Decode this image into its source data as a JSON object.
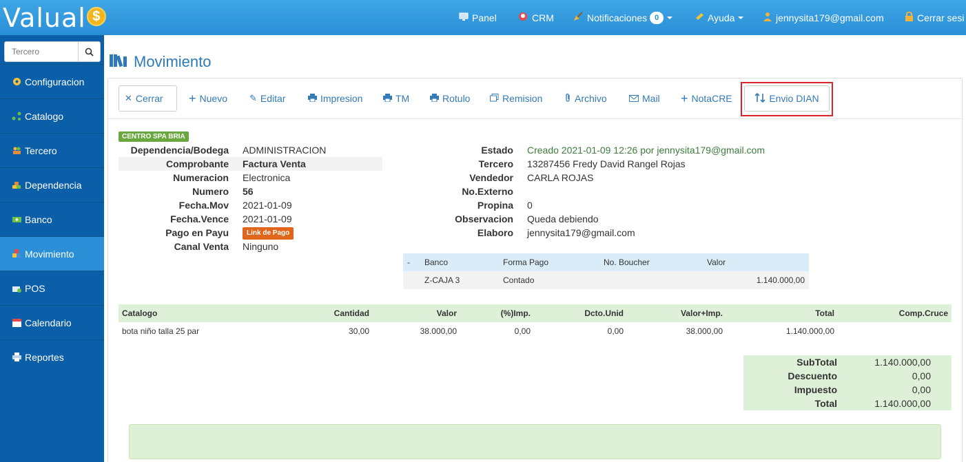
{
  "header": {
    "logo_text": "Valual",
    "logo_symbol": "$",
    "nav": [
      {
        "label": "Panel",
        "icon": "monitor-icon"
      },
      {
        "label": "CRM",
        "icon": "crm-icon"
      },
      {
        "label": "Notificaciones",
        "icon": "broom-icon",
        "badge": "0"
      },
      {
        "label": "Ayuda",
        "icon": "ticket-icon"
      },
      {
        "label": "jennysita179@gmail.com",
        "icon": "user-icon"
      },
      {
        "label": "Cerrar sesi",
        "icon": "lock-icon"
      }
    ]
  },
  "sidebar": {
    "search_placeholder": "Tercero",
    "items": [
      {
        "label": "Configuracion",
        "icon": "gear-icon"
      },
      {
        "label": "Catalogo",
        "icon": "nodes-icon"
      },
      {
        "label": "Tercero",
        "icon": "people-icon"
      },
      {
        "label": "Dependencia",
        "icon": "blocks-icon"
      },
      {
        "label": "Banco",
        "icon": "money-icon"
      },
      {
        "label": "Movimiento",
        "icon": "cubes-icon"
      },
      {
        "label": "POS",
        "icon": "register-icon"
      },
      {
        "label": "Calendario",
        "icon": "calendar-icon"
      },
      {
        "label": "Reportes",
        "icon": "printer-icon"
      }
    ]
  },
  "page": {
    "title": "Movimiento"
  },
  "toolbar": {
    "cerrar": "Cerrar",
    "nuevo": "Nuevo",
    "editar": "Editar",
    "impresion": "Impresion",
    "tm": "TM",
    "rotulo": "Rotulo",
    "remision": "Remision",
    "archivo": "Archivo",
    "mail": "Mail",
    "notacre": "NotaCRE",
    "envio_dian": "Envio DIAN"
  },
  "company_label": "CENTRO SPA BRIA",
  "details_left": [
    {
      "key": "Dependencia/Bodega",
      "value": "ADMINISTRACION"
    },
    {
      "key": "Comprobante",
      "value": "Factura Venta"
    },
    {
      "key": "Numeracion",
      "value": "Electronica"
    },
    {
      "key": "Numero",
      "value": "56"
    },
    {
      "key": "Fecha.Mov",
      "value": "2021-01-09"
    },
    {
      "key": "Fecha.Vence",
      "value": "2021-01-09"
    },
    {
      "key": "Pago en Payu",
      "value": "Link de Pago"
    },
    {
      "key": "Canal Venta",
      "value": "Ninguno"
    }
  ],
  "details_right": [
    {
      "key": "Estado",
      "value": "Creado 2021-01-09 12:26 por jennysita179@gmail.com"
    },
    {
      "key": "Tercero",
      "value": "13287456 Fredy David Rangel Rojas"
    },
    {
      "key": "Vendedor",
      "value": "CARLA ROJAS"
    },
    {
      "key": "No.Externo",
      "value": ""
    },
    {
      "key": "Propina",
      "value": "0"
    },
    {
      "key": "Observacion",
      "value": "Queda debiendo"
    },
    {
      "key": "Elaboro",
      "value": "jennysita179@gmail.com"
    }
  ],
  "bank_table": {
    "headers": [
      "-",
      "Banco",
      "Forma Pago",
      "No. Boucher",
      "Valor"
    ],
    "row": [
      "",
      "Z-CAJA 3",
      "Contado",
      "",
      "1.140.000,00"
    ]
  },
  "items_table": {
    "headers": [
      "Catalogo",
      "Cantidad",
      "Valor",
      "(%)Imp.",
      "Dcto.Unid",
      "Valor+Imp.",
      "Total",
      "Comp.Cruce"
    ],
    "row": [
      "bota niño talla 25 par",
      "30,00",
      "38.000,00",
      "0,00",
      "0,00",
      "38.000,00",
      "1.140.000,00",
      ""
    ]
  },
  "totals": [
    {
      "key": "SubTotal",
      "value": "1.140.000,00"
    },
    {
      "key": "Descuento",
      "value": "0,00"
    },
    {
      "key": "Impuesto",
      "value": "0,00"
    },
    {
      "key": "Total",
      "value": "1.140.000,00"
    }
  ],
  "colors": {
    "header_blue": "#2a8fd6",
    "sidebar_blue": "#0b5ea8",
    "link_blue": "#337ab7",
    "status_green": "#3c7d3c",
    "highlight_red": "#d9232d"
  }
}
